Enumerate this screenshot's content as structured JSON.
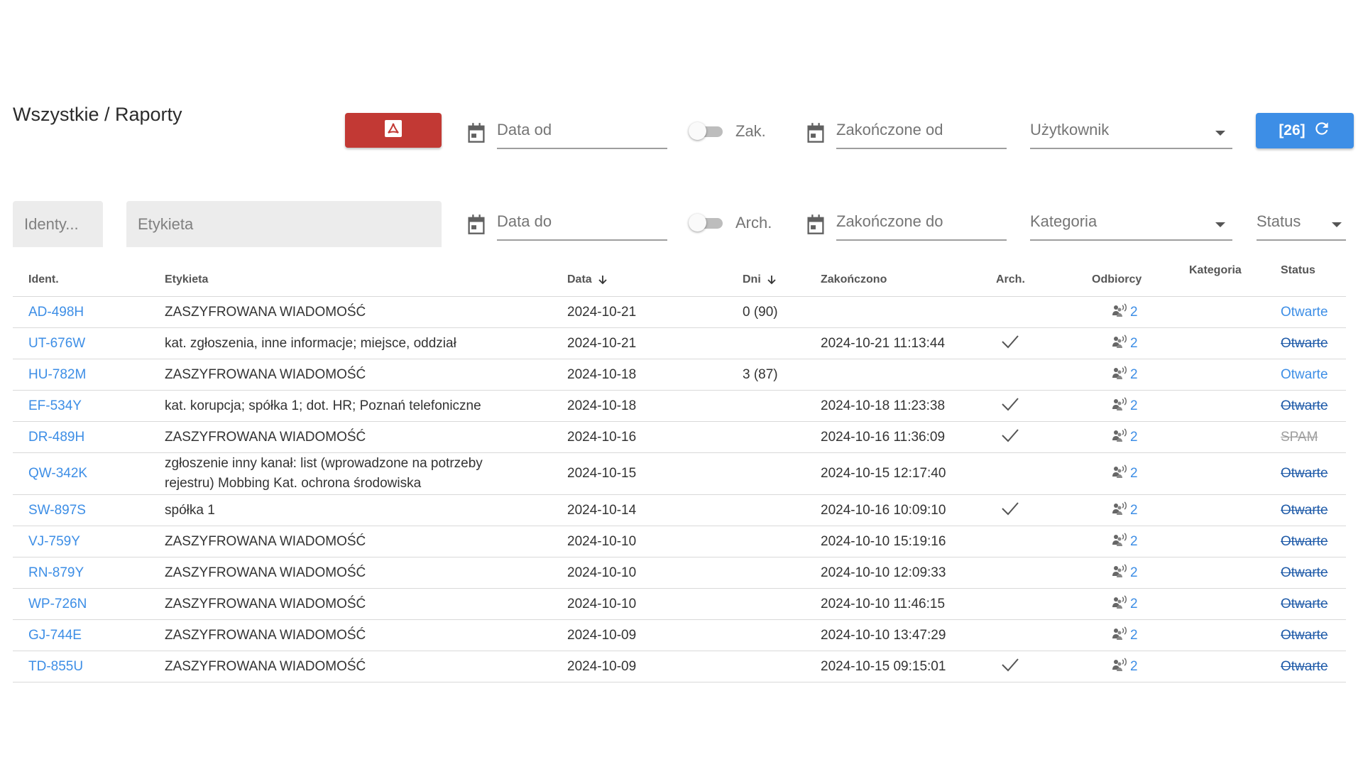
{
  "breadcrumb": "Wszystkie / Raporty",
  "filters": {
    "date_from_placeholder": "Data od",
    "date_to_placeholder": "Data do",
    "toggle_closed_label": "Zak.",
    "toggle_archived_label": "Arch.",
    "closed_from_placeholder": "Zakończone od",
    "closed_to_placeholder": "Zakończone do",
    "user_select": "Użytkownik",
    "category_select": "Kategoria",
    "status_select": "Status",
    "id_placeholder": "Identy...",
    "label_placeholder": "Etykieta",
    "refresh_label": "[26]"
  },
  "colors": {
    "primary": "#3d8ee6",
    "pdf_button": "#c23934",
    "spam": "#9e9e9e"
  },
  "table": {
    "headers": {
      "id": "Ident.",
      "label": "Etykieta",
      "date": "Data",
      "days": "Dni",
      "closed": "Zakończono",
      "arch": "Arch.",
      "recipients": "Odbiorcy",
      "category": "Kategoria",
      "status": "Status"
    },
    "rows": [
      {
        "id": "AD-498H",
        "label": "ZASZYFROWANA WIADOMOŚĆ",
        "date": "2024-10-21",
        "days": "0 (90)",
        "closed": "",
        "arch": false,
        "recipients": "2",
        "status": "Otwarte",
        "status_type": "open"
      },
      {
        "id": "UT-676W",
        "label": "kat. zgłoszenia, inne informacje; miejsce, oddział",
        "date": "2024-10-21",
        "days": "",
        "closed": "2024-10-21 11:13:44",
        "arch": true,
        "recipients": "2",
        "status": "Otwarte",
        "status_type": "closed"
      },
      {
        "id": "HU-782M",
        "label": "ZASZYFROWANA WIADOMOŚĆ",
        "date": "2024-10-18",
        "days": "3 (87)",
        "closed": "",
        "arch": false,
        "recipients": "2",
        "status": "Otwarte",
        "status_type": "open"
      },
      {
        "id": "EF-534Y",
        "label": "kat. korupcja; spółka 1; dot. HR; Poznań telefoniczne",
        "date": "2024-10-18",
        "days": "",
        "closed": "2024-10-18 11:23:38",
        "arch": true,
        "recipients": "2",
        "status": "Otwarte",
        "status_type": "closed"
      },
      {
        "id": "DR-489H",
        "label": "ZASZYFROWANA WIADOMOŚĆ",
        "date": "2024-10-16",
        "days": "",
        "closed": "2024-10-16 11:36:09",
        "arch": true,
        "recipients": "2",
        "status": "SPAM",
        "status_type": "spam"
      },
      {
        "id": "QW-342K",
        "label": "zgłoszenie inny kanał: list (wprowadzone na potrzeby rejestru) Mobbing Kat. ochrona środowiska",
        "date": "2024-10-15",
        "days": "",
        "closed": "2024-10-15 12:17:40",
        "arch": false,
        "recipients": "2",
        "status": "Otwarte",
        "status_type": "closed",
        "tall": true
      },
      {
        "id": "SW-897S",
        "label": "spółka 1",
        "date": "2024-10-14",
        "days": "",
        "closed": "2024-10-16 10:09:10",
        "arch": true,
        "recipients": "2",
        "status": "Otwarte",
        "status_type": "closed"
      },
      {
        "id": "VJ-759Y",
        "label": "ZASZYFROWANA WIADOMOŚĆ",
        "date": "2024-10-10",
        "days": "",
        "closed": "2024-10-10 15:19:16",
        "arch": false,
        "recipients": "2",
        "status": "Otwarte",
        "status_type": "closed"
      },
      {
        "id": "RN-879Y",
        "label": "ZASZYFROWANA WIADOMOŚĆ",
        "date": "2024-10-10",
        "days": "",
        "closed": "2024-10-10 12:09:33",
        "arch": false,
        "recipients": "2",
        "status": "Otwarte",
        "status_type": "closed"
      },
      {
        "id": "WP-726N",
        "label": "ZASZYFROWANA WIADOMOŚĆ",
        "date": "2024-10-10",
        "days": "",
        "closed": "2024-10-10 11:46:15",
        "arch": false,
        "recipients": "2",
        "status": "Otwarte",
        "status_type": "closed"
      },
      {
        "id": "GJ-744E",
        "label": "ZASZYFROWANA WIADOMOŚĆ",
        "date": "2024-10-09",
        "days": "",
        "closed": "2024-10-10 13:47:29",
        "arch": false,
        "recipients": "2",
        "status": "Otwarte",
        "status_type": "closed"
      },
      {
        "id": "TD-855U",
        "label": "ZASZYFROWANA WIADOMOŚĆ",
        "date": "2024-10-09",
        "days": "",
        "closed": "2024-10-15 09:15:01",
        "arch": true,
        "recipients": "2",
        "status": "Otwarte",
        "status_type": "closed"
      }
    ]
  }
}
